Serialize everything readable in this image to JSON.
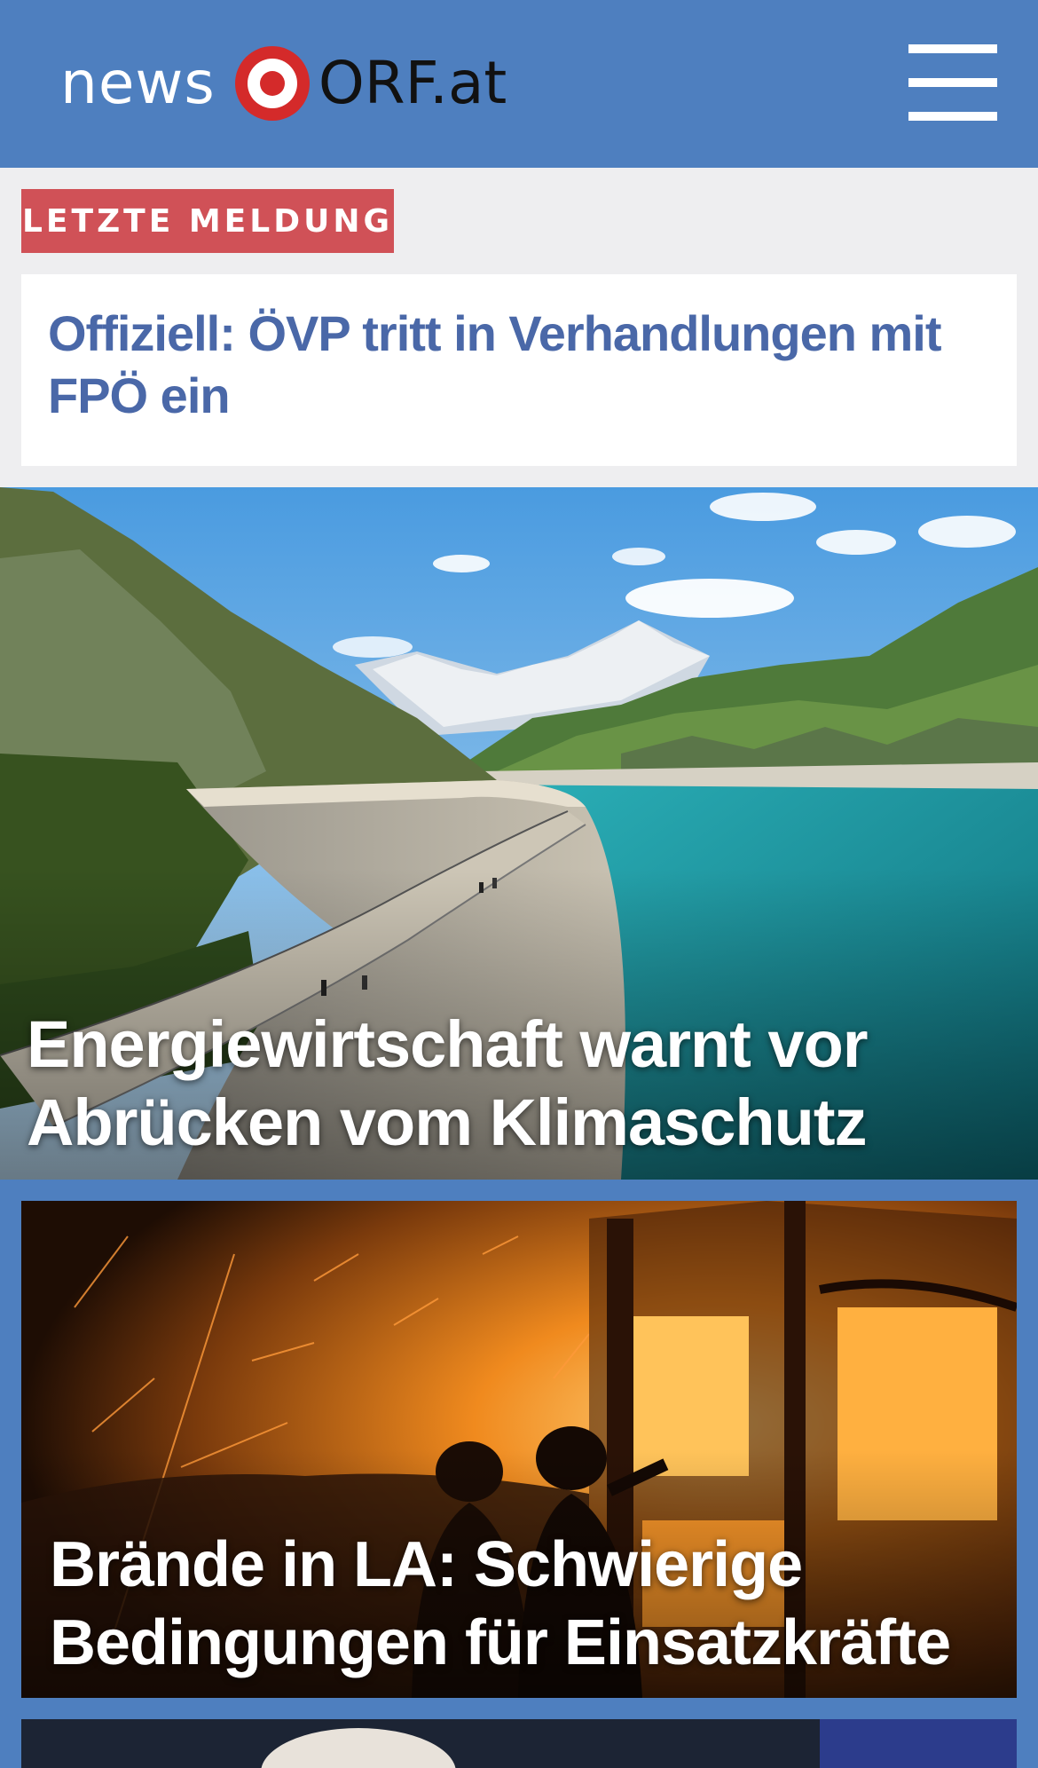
{
  "header": {
    "logo_news": "news",
    "logo_orf": "ORF.at",
    "menu_icon": "hamburger-menu-icon",
    "bg_color": "#4e7fbf"
  },
  "breaking": {
    "badge": "LETZTE MELDUNG",
    "headline": "Offiziell: ÖVP tritt in Verhandlungen mit FPÖ ein",
    "badge_color": "#d05157",
    "headline_color": "#4a68a8"
  },
  "stories": [
    {
      "title": "Energiewirtschaft warnt vor Abrücken vom Klimaschutz"
    },
    {
      "title": "Brände in LA: Schwierige Bedingungen für Einsatzkräfte"
    }
  ]
}
